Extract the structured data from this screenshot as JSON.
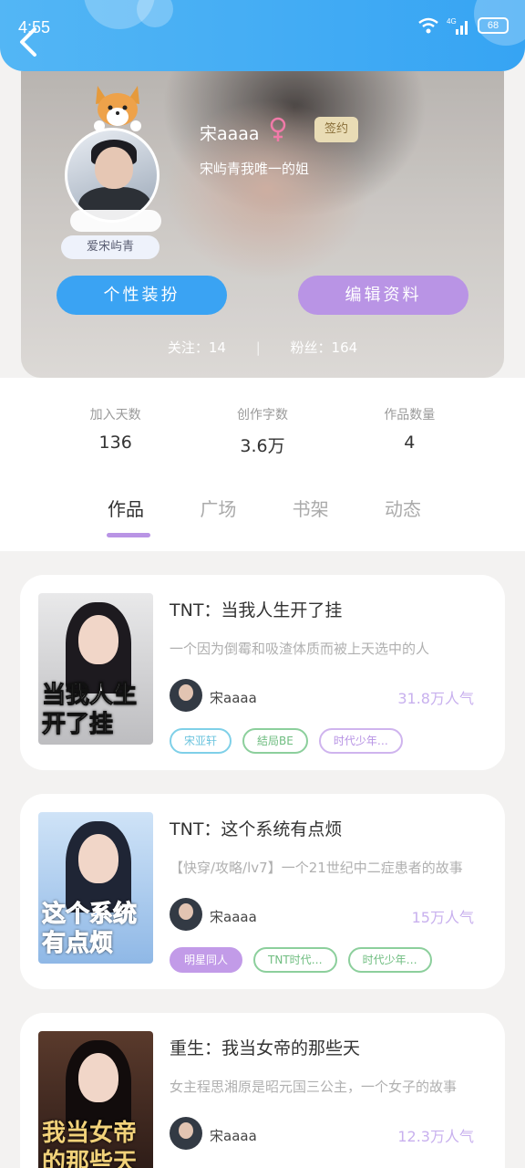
{
  "status_bar": {
    "time": "4:55",
    "network": "4G",
    "battery": "68"
  },
  "profile": {
    "nickname_badge": "爱宋屿青",
    "user_name": "宋aaaa",
    "gender": "female",
    "sign_badge": "签约",
    "bio": "宋屿青我唯一的姐",
    "dress_button": "个性装扮",
    "edit_button": "编辑资料",
    "follow_label": "关注：14",
    "fans_label": "粉丝：164"
  },
  "stats": [
    {
      "label": "加入天数",
      "value": "136"
    },
    {
      "label": "创作字数",
      "value": "3.6万"
    },
    {
      "label": "作品数量",
      "value": "4"
    }
  ],
  "tabs": [
    {
      "label": "作品",
      "active": true
    },
    {
      "label": "广场",
      "active": false
    },
    {
      "label": "书架",
      "active": false
    },
    {
      "label": "动态",
      "active": false
    }
  ],
  "books": [
    {
      "title": "TNT：当我人生开了挂",
      "cover_text": "当我人生开了挂",
      "description": "一个因为倒霉和吸渣体质而被上天选中的人",
      "author": "宋aaaa",
      "readers": "31.8万人气",
      "tags": [
        {
          "label": "宋亚轩",
          "style": "cyan"
        },
        {
          "label": "結局BE",
          "style": "green"
        },
        {
          "label": "时代少年…",
          "style": "purple"
        }
      ]
    },
    {
      "title": "TNT：这个系统有点烦",
      "cover_text": "这个系统有点烦",
      "description": "【快穿/攻略/lv7】一个21世纪中二症患者的故事",
      "author": "宋aaaa",
      "readers": "15万人气",
      "tags": [
        {
          "label": "明星同人",
          "style": "filled"
        },
        {
          "label": "TNT时代…",
          "style": "green"
        },
        {
          "label": "时代少年…",
          "style": "green"
        }
      ]
    },
    {
      "title": "重生：我当女帝的那些天",
      "cover_text": "我当女帝的那些天",
      "description": "女主程思湘原是昭元国三公主，一个女子的故事",
      "author": "宋aaaa",
      "readers": "12.3万人气",
      "tags": []
    }
  ]
}
